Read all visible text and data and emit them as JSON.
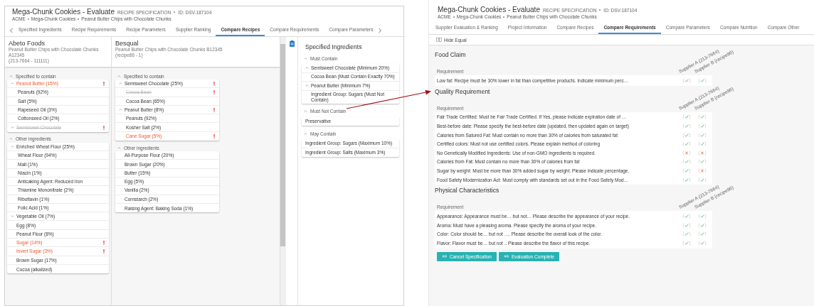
{
  "left_window": {
    "title": "Mega-Chunk Cookies - Evaluate",
    "doc_type": "RECIPE SPECIFICATION",
    "doc_id": "ID: DSV-187104",
    "breadcrumb": [
      "ACME",
      "Mega-Chunk Cookies",
      "Peanut Butter Chips with Chocolate Chunks"
    ],
    "tabs": [
      {
        "label": "Specified Ingredients",
        "selected": false
      },
      {
        "label": "Recipe Requirements",
        "selected": false
      },
      {
        "label": "Recipe Parameters",
        "selected": false
      },
      {
        "label": "Supplier Ranking",
        "selected": false
      },
      {
        "label": "Compare Recipes",
        "selected": true
      },
      {
        "label": "Compare Requirements",
        "selected": false
      },
      {
        "label": "Compare Parameters",
        "selected": false
      }
    ],
    "suppliers": [
      {
        "name": "Abeto Foods",
        "product": "Peanut Butter Chips with Chocolate Chunks A12345",
        "code": "(213-7664 - 111111)",
        "sections": [
          {
            "title": "Specified to contain",
            "expanded": true,
            "items": [
              {
                "label": "Peanut Butter (15%)",
                "deviation": true,
                "removed": false,
                "flag": true,
                "expanded": true,
                "children": [
                  {
                    "label": "Peanuts (92%)",
                    "deviation": false,
                    "removed": false,
                    "flag": false
                  },
                  {
                    "label": "Salt (5%)",
                    "deviation": false,
                    "removed": false,
                    "flag": false
                  },
                  {
                    "label": "Rapeseed Oil (3%)",
                    "deviation": false,
                    "removed": false,
                    "flag": false
                  },
                  {
                    "label": "Cottonseed Oil (2%)",
                    "deviation": false,
                    "removed": false,
                    "flag": false
                  }
                ]
              },
              {
                "label": "Semisweet Chocolate",
                "deviation": false,
                "removed": true,
                "flag": true,
                "expanded": false
              }
            ]
          },
          {
            "title": "Other ingredients",
            "expanded": true,
            "items": [
              {
                "label": "Enriched Wheat Flour (25%)",
                "deviation": false,
                "removed": false,
                "flag": false,
                "expanded": true,
                "children": [
                  {
                    "label": "Wheat Flour (94%)",
                    "deviation": false,
                    "removed": false,
                    "flag": false
                  },
                  {
                    "label": "Malt (1%)",
                    "deviation": false,
                    "removed": false,
                    "flag": false
                  },
                  {
                    "label": "Niacin (1%)",
                    "deviation": false,
                    "removed": false,
                    "flag": false
                  },
                  {
                    "label": "Anticaking Agent: Reduced Iron",
                    "deviation": false,
                    "removed": false,
                    "flag": false
                  },
                  {
                    "label": "Thiamine Mononitrate (2%)",
                    "deviation": false,
                    "removed": false,
                    "flag": false
                  },
                  {
                    "label": "Riboflavin (1%)",
                    "deviation": false,
                    "removed": false,
                    "flag": false
                  },
                  {
                    "label": "Folic Acid (1%)",
                    "deviation": false,
                    "removed": false,
                    "flag": false
                  }
                ]
              },
              {
                "label": "Vegetable Oil (7%)",
                "deviation": false,
                "removed": false,
                "flag": false,
                "expanded": false
              },
              {
                "label": "Egg (8%)",
                "deviation": false,
                "removed": false,
                "flag": false
              },
              {
                "label": "Peanut Flour (8%)",
                "deviation": false,
                "removed": false,
                "flag": false
              },
              {
                "label": "Sugar (14%)",
                "deviation": true,
                "removed": false,
                "flag": true
              },
              {
                "label": "Invert Sugar (3%)",
                "deviation": true,
                "removed": false,
                "flag": true
              },
              {
                "label": "Brown Sugar (17%)",
                "deviation": false,
                "removed": false,
                "flag": false
              },
              {
                "label": "Cocoa (alkalized)",
                "deviation": false,
                "removed": false,
                "flag": false
              }
            ]
          }
        ]
      },
      {
        "name": "Besqual",
        "product": "Peanut Butter Chips with Chocolate Chunks B12345",
        "code": "(recipe86 - 1)",
        "sections": [
          {
            "title": "Specified to contain",
            "expanded": true,
            "items": [
              {
                "label": "Semisweet Chocolate (25%)",
                "deviation": false,
                "removed": false,
                "flag": true,
                "expanded": true,
                "children": [
                  {
                    "label": "Cocoa Bean",
                    "deviation": false,
                    "removed": true,
                    "flag": true
                  },
                  {
                    "label": "Cocoa Bean (65%)",
                    "deviation": false,
                    "removed": false,
                    "flag": false
                  }
                ]
              },
              {
                "label": "Peanut Butter (8%)",
                "deviation": false,
                "removed": false,
                "flag": true,
                "expanded": true,
                "children": [
                  {
                    "label": "Peanuts (92%)",
                    "deviation": false,
                    "removed": false,
                    "flag": false
                  },
                  {
                    "label": "Kosher Salt (2%)",
                    "deviation": false,
                    "removed": false,
                    "flag": false
                  },
                  {
                    "label": "Cane Sugar (5%)",
                    "deviation": true,
                    "removed": false,
                    "flag": true
                  }
                ]
              }
            ]
          },
          {
            "title": "Other ingredients",
            "expanded": true,
            "items": [
              {
                "label": "All-Purpose Flour (20%)",
                "deviation": false,
                "removed": false,
                "flag": false
              },
              {
                "label": "Brown Sugar (20%)",
                "deviation": false,
                "removed": false,
                "flag": false
              },
              {
                "label": "Butter (15%)",
                "deviation": false,
                "removed": false,
                "flag": false
              },
              {
                "label": "Egg (5%)",
                "deviation": false,
                "removed": false,
                "flag": false
              },
              {
                "label": "Vanilla (2%)",
                "deviation": false,
                "removed": false,
                "flag": false
              },
              {
                "label": "Cornstarch (2%)",
                "deviation": false,
                "removed": false,
                "flag": false
              },
              {
                "label": "Raising Agent: Baking Soda (1%)",
                "deviation": false,
                "removed": false,
                "flag": false
              }
            ]
          }
        ]
      }
    ],
    "spec_panel": {
      "title": "Specified Ingredients",
      "groups": [
        {
          "title": "Must Contain",
          "expanded": true,
          "items": [
            {
              "label": "Semisweet Chocolate (Minimum 20%)",
              "expanded": true,
              "children": [
                {
                  "label": "Cocoa Bean (Must Contain Exactly 70%)"
                }
              ]
            },
            {
              "label": "Peanut Butter (Minimum 7%)",
              "expanded": true,
              "children": [
                {
                  "label": "Ingredient Group: Sugars (Must Not Contain)"
                }
              ]
            }
          ]
        },
        {
          "title": "Must Not Contain",
          "expanded": true,
          "items": [
            {
              "label": "Preservative"
            }
          ]
        },
        {
          "title": "May Contain",
          "expanded": true,
          "items": [
            {
              "label": "Ingredient Group: Sugars (Maximum 10%)"
            },
            {
              "label": "Ingredient Group: Salts (Maximum 3%)"
            }
          ]
        }
      ]
    }
  },
  "right_window": {
    "title": "Mega-Chunk Cookies - Evaluate",
    "doc_type": "RECIPE SPECIFICATION",
    "doc_id": "ID: DSV-187104",
    "breadcrumb": [
      "ACME",
      "Mega-Chunk Cookies",
      "Peanut Butter Chips with Chocolate Chunks"
    ],
    "tabs": [
      {
        "label": "Supplier Evaluation & Ranking",
        "selected": false
      },
      {
        "label": "Project Information",
        "selected": false
      },
      {
        "label": "Compare Recipes",
        "selected": false
      },
      {
        "label": "Compare Requirements",
        "selected": true
      },
      {
        "label": "Compare Parameters",
        "selected": false
      },
      {
        "label": "Compare Nutrition",
        "selected": false
      },
      {
        "label": "Compare Other",
        "selected": false
      }
    ],
    "toolbar": {
      "label": "Hide Equal"
    },
    "sections": [
      {
        "title": "Food Claim",
        "columns": [
          "Requirement",
          "Supplier A (213-7664)",
          "Supplier B (recipe86)"
        ],
        "rows": [
          {
            "text": "Low fat: Recipe must be 30% lower in fat than competitive products. Indicate minimum perc…",
            "results": [
              {
                "passed": true
              },
              {
                "passed": true
              }
            ]
          }
        ]
      },
      {
        "title": "Quality Requirement",
        "columns": [
          "Requirement",
          "Supplier A (213-7664)",
          "Supplier B (recipe86)"
        ],
        "rows": [
          {
            "text": "Fair Trade Certified: Must be Fair Trade Certified. If Yes, please indicate expiration date of …",
            "results": [
              {
                "passed": true
              },
              {
                "passed": true
              }
            ]
          },
          {
            "text": "Best-before date: Please specify the best-before date (updated, then updated again on target)",
            "results": [
              {
                "passed": true
              },
              {
                "passed": true
              }
            ]
          },
          {
            "text": "Calories from Satured Fat: Must contain no more than 30% of calories from saturated fat",
            "results": [
              {
                "passed": true
              },
              {
                "passed": true
              }
            ]
          },
          {
            "text": "Certified colors: Must not use certified colors. Please explain method of coloring",
            "results": [
              {
                "passed": true
              },
              {
                "passed": true
              }
            ]
          },
          {
            "text": "No Genetically Modified Ingredients: Use of non-GMO ingredients is required.",
            "results": [
              {
                "passed": false
              },
              {
                "passed": false
              }
            ]
          },
          {
            "text": "Calories from Fat: Must contain no more than 30% of calories from fat",
            "results": [
              {
                "passed": true
              },
              {
                "passed": true
              }
            ]
          },
          {
            "text": "Sugar by weight: Must be more than 30% added sugar by weight. Please indicate percentage.",
            "results": [
              {
                "passed": true
              },
              {
                "passed": false
              }
            ]
          },
          {
            "text": "Food Safety Modernization Act: Must comply with standards set out in the Food Safety Mod…",
            "results": [
              {
                "passed": true
              },
              {
                "passed": true
              }
            ]
          }
        ]
      },
      {
        "title": "Physical Characteristics",
        "columns": [
          "Requirement",
          "Supplier A (213-7664)",
          "Supplier B (recipe86)"
        ],
        "rows": [
          {
            "text": "Appearance: Appearance must be… but not… Please describe the appearance of your recipe.",
            "results": [
              {
                "passed": true
              },
              {
                "passed": true
              }
            ]
          },
          {
            "text": "Aroma: Must have a pleasing aroma. Please specify the aroma of your recipe.",
            "results": [
              {
                "passed": true
              },
              {
                "passed": true
              }
            ]
          },
          {
            "text": "Color: Color should be… but not …. Please describe the overall look of the color.",
            "results": [
              {
                "passed": true
              },
              {
                "passed": true
              }
            ]
          },
          {
            "text": "Flavor: Flavor must be… but not .. Please describe the flavor of this recipe.",
            "results": [
              {
                "passed": true
              },
              {
                "passed": true
              }
            ]
          }
        ]
      }
    ],
    "buttons": [
      "Cancel Specification",
      "Evaluation Complete"
    ]
  }
}
